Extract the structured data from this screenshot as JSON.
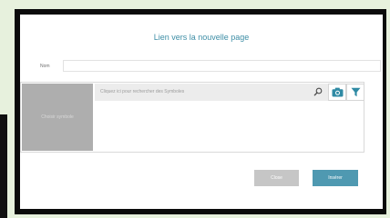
{
  "dialog": {
    "title": "Lien vers la nouvelle page",
    "name_label": "Nom",
    "name_value": ""
  },
  "symbol_panel": {
    "picker_label": "Choisir symbole",
    "search_placeholder": "Cliquez ici pour rechercher des Symboles",
    "icons": [
      "search-icon",
      "camera-icon",
      "filter-icon"
    ],
    "accent_color": "#3e8ea6"
  },
  "footer": {
    "close_label": "Close",
    "insert_label": "Insérer"
  }
}
